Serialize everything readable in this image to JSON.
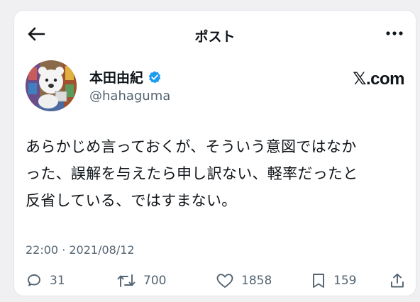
{
  "header": {
    "title": "ポスト",
    "back_icon": "arrow-left-icon",
    "more_icon": "more-horizontal-icon"
  },
  "author": {
    "display_name": "本田由紀",
    "handle": "@hahaguma",
    "verified_badge_color": "#1d9bf0",
    "source": "𝕏.com"
  },
  "post": {
    "lines": [
      "あらかじめ言っておくが、そういう意図ではなか",
      "った、誤解を与えたら申し訳ない、軽率だったと",
      "反省している、ではすまない。"
    ],
    "timestamp": "22:00 · 2021/08/12"
  },
  "actions": {
    "replies": "31",
    "reposts": "700",
    "likes": "1858",
    "bookmarks": "159"
  },
  "colors": {
    "text": "#0f1419",
    "secondary": "#536471",
    "accent": "#1d9bf0",
    "background": "#ffffff"
  }
}
